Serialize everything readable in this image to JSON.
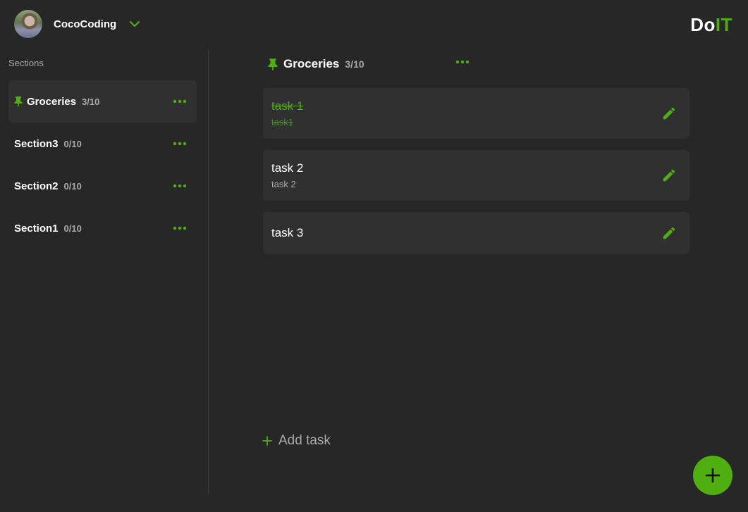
{
  "user": {
    "name": "CocoCoding"
  },
  "logo": {
    "part1": "Do",
    "part2": "IT"
  },
  "sidebar": {
    "heading": "Sections",
    "items": [
      {
        "name": "Groceries",
        "count": "3/10",
        "pinned": true,
        "active": true
      },
      {
        "name": "Section3",
        "count": "0/10",
        "pinned": false,
        "active": false
      },
      {
        "name": "Section2",
        "count": "0/10",
        "pinned": false,
        "active": false
      },
      {
        "name": "Section1",
        "count": "0/10",
        "pinned": false,
        "active": false
      }
    ]
  },
  "main": {
    "title": "Groceries",
    "count": "3/10",
    "tasks": [
      {
        "title": "task 1",
        "description": "task1",
        "completed": true
      },
      {
        "title": "task 2",
        "description": "task 2",
        "completed": false
      },
      {
        "title": "task 3",
        "description": "",
        "completed": false
      }
    ],
    "add_task_label": "Add task"
  },
  "colors": {
    "accent": "#4fae10",
    "background": "#272727",
    "card": "#303030",
    "muted_text": "#a9a9a9"
  },
  "icons": {
    "pin": "pin-icon",
    "more": "more-horizontal-icon",
    "edit": "pencil-icon",
    "add": "plus-icon",
    "chevron": "chevron-down-icon"
  }
}
